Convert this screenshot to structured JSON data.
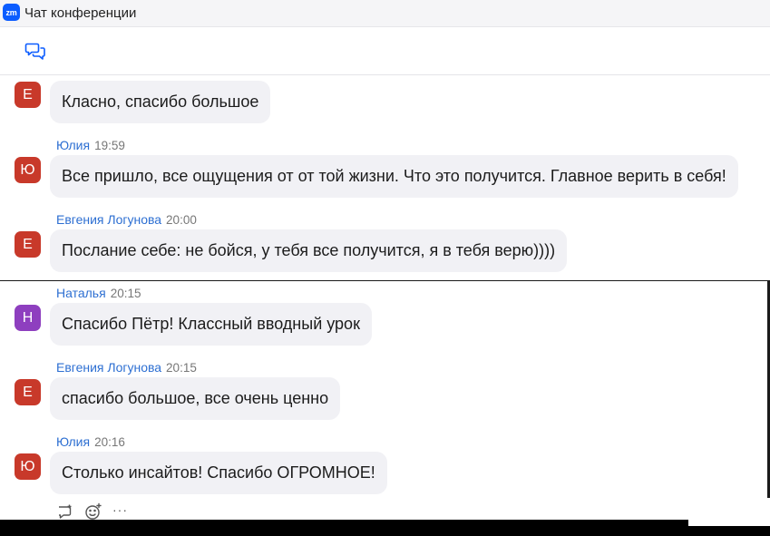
{
  "window": {
    "logo_text": "zm",
    "title": "Чат конференции"
  },
  "colors": {
    "accent": "#0b5cff",
    "name_link": "#2d6fd2",
    "bubble": "#f1f1f5",
    "avatar_e": "#c8392a",
    "avatar_yu": "#c8392a",
    "avatar_n": "#8e3fbf"
  },
  "toolbar": {
    "icon": "chat-bubbles-icon"
  },
  "messages": [
    {
      "avatar": "Е",
      "avatar_color": "#c8392a",
      "sender": "",
      "time": "",
      "text": "Класно, спасибо большое"
    },
    {
      "avatar": "Ю",
      "avatar_color": "#c8392a",
      "sender": "Юлия",
      "time": "19:59",
      "text": "Все пришло, все ощущения от от той жизни. Что это получится. Главное верить в себя!"
    },
    {
      "avatar": "Е",
      "avatar_color": "#c8392a",
      "sender": "Евгения Логунова",
      "time": "20:00",
      "text": "Послание себе: не бойся,  у тебя все получится, я в тебя верю))))"
    },
    {
      "avatar": "Н",
      "avatar_color": "#8e3fbf",
      "sender": "Наталья",
      "time": "20:15",
      "text": "Спасибо Пётр! Классный вводный урок"
    },
    {
      "avatar": "Е",
      "avatar_color": "#c8392a",
      "sender": "Евгения Логунова",
      "time": "20:15",
      "text": "спасибо большое, все очень ценно"
    },
    {
      "avatar": "Ю",
      "avatar_color": "#c8392a",
      "sender": "Юлия",
      "time": "20:16",
      "text": "Столько инсайтов! Спасибо ОГРОМНОЕ!"
    }
  ],
  "message_actions": {
    "reply_icon": "reply-icon",
    "reaction_icon": "add-reaction-icon",
    "more_label": "···"
  }
}
